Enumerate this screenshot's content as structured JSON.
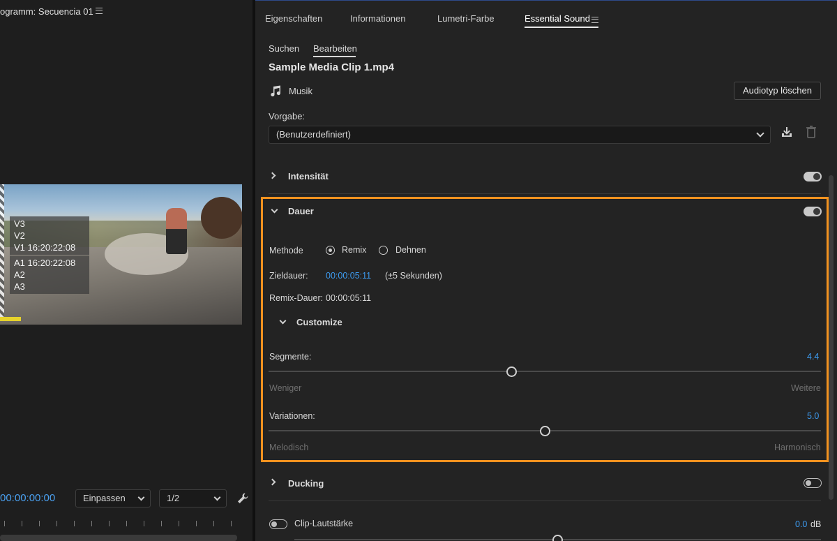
{
  "left": {
    "title": "ogramm: Secuencia 01",
    "overlay_top": [
      "V3",
      "V2",
      "V1 16:20:22:08"
    ],
    "overlay_bottom": [
      "A1 16:20:22:08",
      "A2",
      "A3"
    ],
    "timecode": "00:00:00:00",
    "fit_dropdown": "Einpassen",
    "resolution_dropdown": "1/2"
  },
  "tabs": [
    {
      "label": "Eigenschaften"
    },
    {
      "label": "Informationen"
    },
    {
      "label": "Lumetri-Farbe"
    },
    {
      "label": "Essential Sound",
      "active": true
    }
  ],
  "subtabs": [
    {
      "label": "Suchen"
    },
    {
      "label": "Bearbeiten",
      "active": true
    }
  ],
  "clip": {
    "name": "Sample Media Clip 1.mp4",
    "audio_type": "Musik",
    "clear_button": "Audiotyp löschen"
  },
  "preset": {
    "label": "Vorgabe:",
    "value": "(Benutzerdefiniert)"
  },
  "sections": {
    "intensity": {
      "label": "Intensität",
      "enabled": true
    },
    "duration": {
      "label": "Dauer",
      "enabled": true,
      "method_label": "Methode",
      "method_options": [
        "Remix",
        "Dehnen"
      ],
      "method_selected": "Remix",
      "target_label": "Zieldauer:",
      "target_value": "00:00:05:11",
      "target_hint": "(±5 Sekunden)",
      "remix_label": "Remix-Dauer:",
      "remix_value": "00:00:05:11",
      "customize_label": "Customize",
      "segments": {
        "label": "Segmente:",
        "value": "4.4",
        "min_label": "Weniger",
        "max_label": "Weitere",
        "fraction": 0.44
      },
      "variations": {
        "label": "Variationen:",
        "value": "5.0",
        "min_label": "Melodisch",
        "max_label": "Harmonisch",
        "fraction": 0.5
      }
    },
    "ducking": {
      "label": "Ducking",
      "enabled": false
    },
    "clip_volume": {
      "label": "Clip-Lautstärke",
      "value": "0.0",
      "unit": "dB",
      "enabled": false
    }
  },
  "colors": {
    "accent_blue": "#3d9bf0",
    "highlight_orange": "#f2921f"
  }
}
